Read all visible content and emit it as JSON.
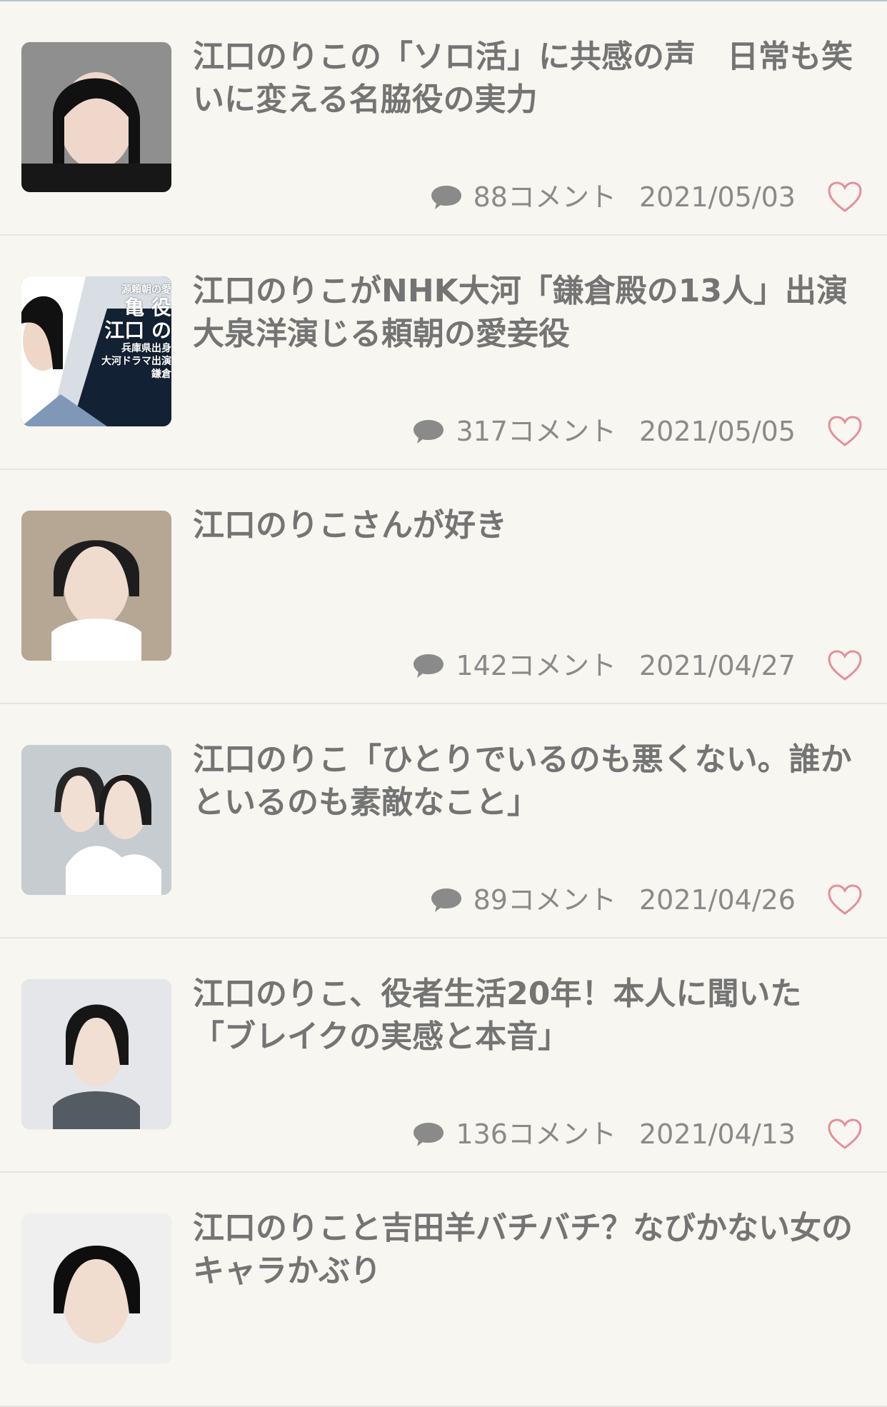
{
  "articles": [
    {
      "title": "江口のりこの「ソロ活」に共感の声　日常も笑いに変える名脇役の実力",
      "comments": "88コメント",
      "date": "2021/05/03",
      "thumbnail": "portrait-dark-bob"
    },
    {
      "title": "江口のりこがNHK大河「鎌倉殿の13人」出演　大泉洋演じる頼朝の愛妾役",
      "comments": "317コメント",
      "date": "2021/05/05",
      "thumbnail": "news-banner",
      "thumb_text": {
        "line1": "源頼朝の愛",
        "line2": "亀 役",
        "line3": "江口 の",
        "line4": "兵庫県出身",
        "line5": "大河ドラマ出演",
        "line6": "鎌倉"
      }
    },
    {
      "title": "江口のりこさんが好き",
      "comments": "142コメント",
      "date": "2021/04/27",
      "thumbnail": "portrait-white-shirt"
    },
    {
      "title": "江口のりこ「ひとりでいるのも悪くない。誰かといるのも素敵なこと」",
      "comments": "89コメント",
      "date": "2021/04/26",
      "thumbnail": "double-portrait"
    },
    {
      "title": "江口のりこ、役者生活20年！本人に聞いた「ブレイクの実感と本音」",
      "comments": "136コメント",
      "date": "2021/04/13",
      "thumbnail": "portrait-gray-shirt"
    },
    {
      "title": "江口のりこと吉田羊バチバチ？なびかない女のキャラかぶり",
      "comments": "",
      "date": "",
      "thumbnail": "portrait-close"
    }
  ],
  "colors": {
    "background": "#f8f6f1",
    "title": "#747474",
    "meta": "#8a8a8a",
    "heart": "#e58f99",
    "comment_icon": "#8a8a8a"
  }
}
